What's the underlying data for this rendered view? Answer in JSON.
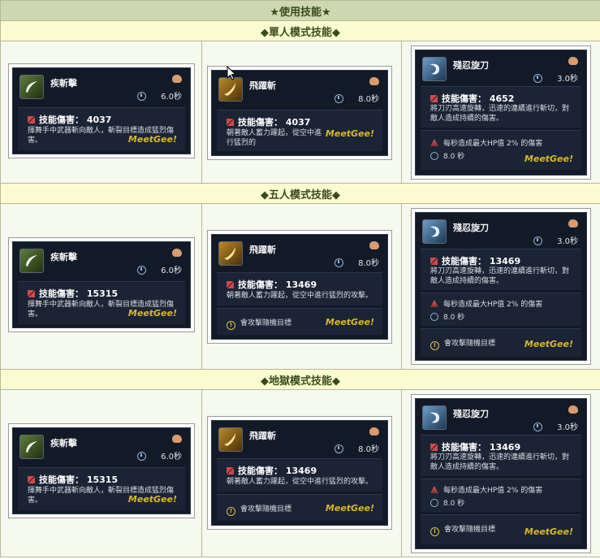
{
  "title": "★使用技能★",
  "sections": [
    {
      "title": "◆單人模式技能◆"
    },
    {
      "title": "◆五人模式技能◆"
    },
    {
      "title": "◆地獄模式技能◆"
    }
  ],
  "skill_names": {
    "a": "疾斬擊",
    "b": "飛躍斬",
    "c": "殘忍旋刀"
  },
  "cooldowns": {
    "a": "6.0秒",
    "b": "8.0秒",
    "c": "3.0秒"
  },
  "damage_label": "技能傷害：",
  "damages": {
    "s1": {
      "a": "4037",
      "b": "4037",
      "c": "4652"
    },
    "s2": {
      "a": "15315",
      "b": "13469",
      "c": "13469"
    },
    "s3": {
      "a": "15315",
      "b": "13469",
      "c": "13469"
    }
  },
  "descs": {
    "a": "揮舞手中武器斬向敵人，斬裂目標造成猛烈傷害。",
    "b1": "朝著敵人蓄力躍起，從空中進行猛烈的",
    "b2": "朝著敵人蓄力躍起，從空中進行猛烈的攻擊。",
    "c": "將刀刃高速旋轉，迅速的連續進行斬切，對敵人造成持續的傷害。"
  },
  "hp_effect": "每秒造成最大HP值 2% 的傷害",
  "duration": "8.0 秒",
  "stun_note": "會攻擊隨機目標",
  "logo": "MeetGee!",
  "colors": {
    "header_bg": "#cdd8b0",
    "section_bg": "#fbfbd2",
    "tooltip_bg": "#121a28",
    "logo": "#d9b52b"
  }
}
